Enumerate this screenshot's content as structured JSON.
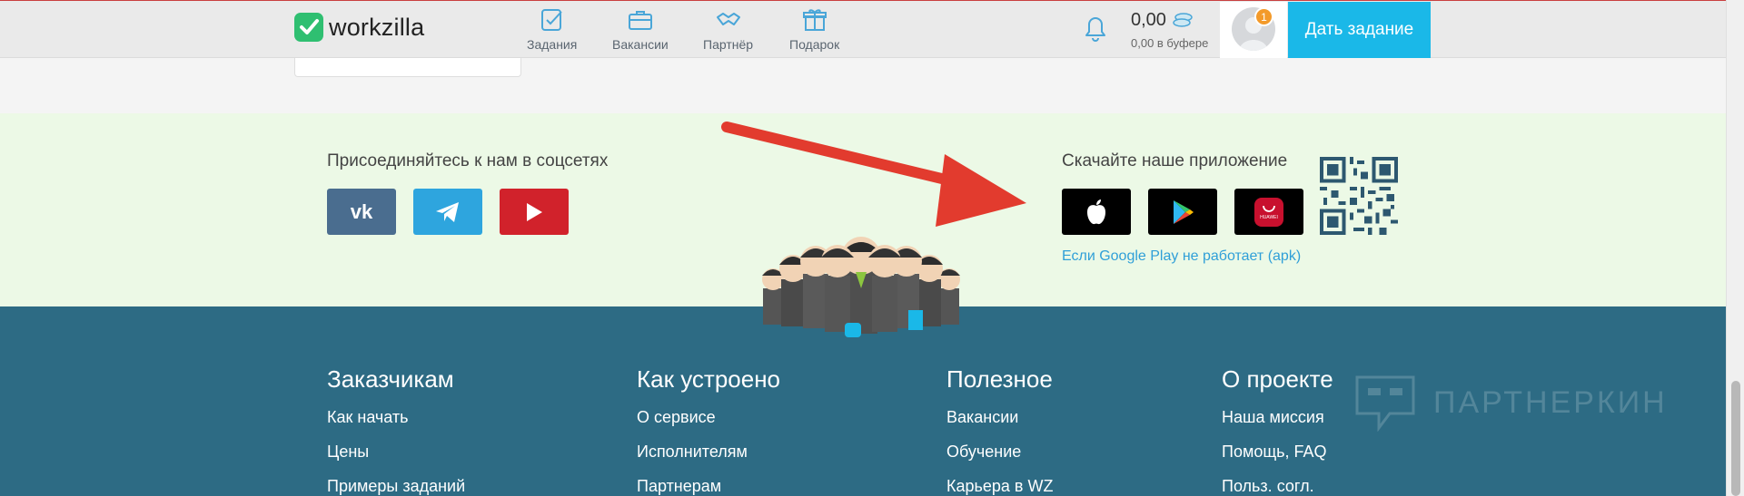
{
  "header": {
    "logo_text": "workzilla",
    "nav": [
      {
        "label": "Задания",
        "icon": "tasks-icon"
      },
      {
        "label": "Вакансии",
        "icon": "briefcase-icon"
      },
      {
        "label": "Партнёр",
        "icon": "handshake-icon"
      },
      {
        "label": "Подарок",
        "icon": "gift-icon"
      }
    ],
    "balance": "0,00",
    "buffer": "0,00 в буфере",
    "notification_count": "1",
    "cta_label": "Дать задание"
  },
  "social": {
    "title": "Присоединяйтесь к нам в соцсетях",
    "buttons": [
      {
        "name": "vk",
        "color": "#4a6d8f"
      },
      {
        "name": "telegram",
        "color": "#2ea5de"
      },
      {
        "name": "youtube",
        "color": "#d1222b"
      }
    ]
  },
  "apps": {
    "title": "Скачайте наше приложение",
    "stores": [
      "App Store",
      "Google Play",
      "Huawei AppGallery"
    ],
    "apk_link": "Если Google Play не работает (apk)"
  },
  "footer": {
    "columns": [
      {
        "title": "Заказчикам",
        "links": [
          "Как начать",
          "Цены",
          "Примеры заданий"
        ]
      },
      {
        "title": "Как устроено",
        "links": [
          "О сервисе",
          "Исполнителям",
          "Партнерам"
        ]
      },
      {
        "title": "Полезное",
        "links": [
          "Вакансии",
          "Обучение",
          "Карьера в WZ"
        ]
      },
      {
        "title": "О проекте",
        "links": [
          "Наша миссия",
          "Помощь, FAQ",
          "Польз. согл."
        ]
      }
    ],
    "watermark": "ПАРТНЕРКИН"
  },
  "colors": {
    "accent": "#1ab8e8",
    "brand_green": "#2fbf71",
    "footer_bg": "#2d6b84",
    "band_bg": "#ecf9e6",
    "arrow": "#e23b2e"
  }
}
